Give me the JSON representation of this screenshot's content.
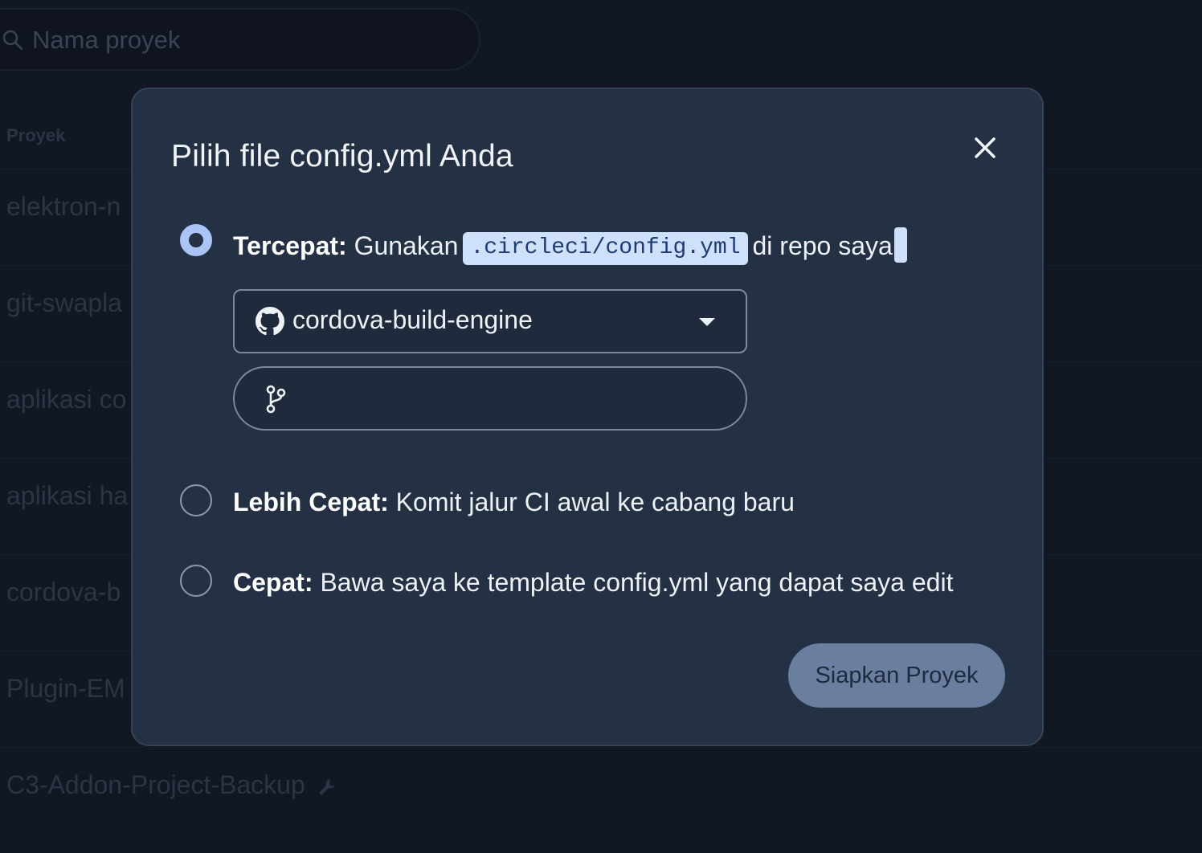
{
  "background": {
    "search_placeholder": "Nama proyek",
    "column_header": "Proyek",
    "projects": [
      "elektron-n",
      "git-swapla",
      "aplikasi co",
      "aplikasi ha",
      "cordova-b",
      "Plugin-EM",
      "C3-Addon-Project-Backup"
    ]
  },
  "modal": {
    "title": "Pilih file config.yml Anda",
    "options": [
      {
        "label_bold": "Tercepat:",
        "label_pre": "Gunakan",
        "code": ".circleci/config.yml",
        "label_post": "di repo saya",
        "selected": true
      },
      {
        "label_bold": "Lebih Cepat:",
        "label_text": "Komit jalur CI awal ke cabang baru",
        "selected": false
      },
      {
        "label_bold": "Cepat:",
        "label_text": "Bawa saya ke template config.yml yang dapat saya edit",
        "selected": false
      }
    ],
    "repo_select": {
      "value": "cordova-build-engine",
      "icon": "github-icon"
    },
    "branch_input": {
      "value": "",
      "icon": "git-branch-icon"
    },
    "submit_label": "Siapkan Proyek"
  },
  "colors": {
    "modal_bg": "#243044",
    "page_bg": "#111723",
    "accent_chip": "#cfe0fb",
    "radio_selected": "#a9c4f5",
    "button_bg": "#6a7ea0"
  }
}
